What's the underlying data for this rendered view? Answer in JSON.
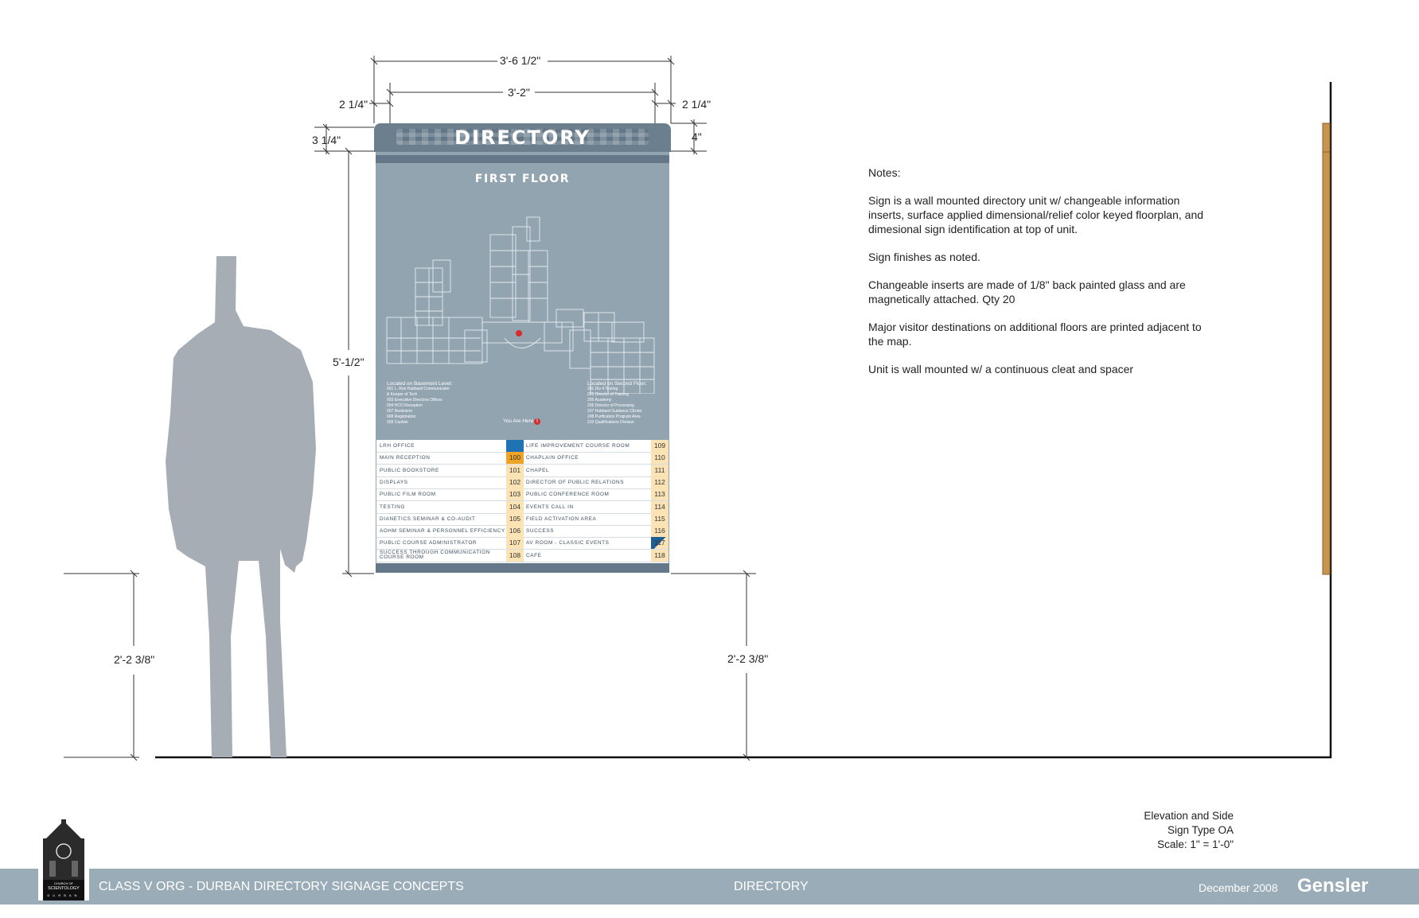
{
  "dimensions": {
    "overall_width": "3'-6 1/2\"",
    "inner_width": "3'-2\"",
    "left_offset": "2 1/4\"",
    "right_offset": "2 1/4\"",
    "header_height_left": "3 1/4\"",
    "header_height_right": "4\"",
    "sign_height": "5'-1/2\"",
    "mount_height_left": "2'-2 3/8\"",
    "mount_height_right": "2'-2 3/8\""
  },
  "sign": {
    "title": "DIRECTORY",
    "floor": "FIRST FLOOR",
    "basement_heading": "Located on Basement Level:",
    "basement_items": [
      "001   L. Ron Hubbard Communicator",
      "         & Keeper of Tech",
      "003   Executive Directors Offices",
      "004   HCO Reception",
      "007   Bookstore",
      "008   Registration",
      "009   Cashier"
    ],
    "second_heading": "Located on Second Floor:",
    "second_items": [
      "201   Div 4 Testing",
      "202   Director of Training",
      "205   Academy",
      "206   Director of Processing",
      "207   Hubbard Guidance CEnter",
      "208   Purification Program Area",
      "210   Qualifications Division"
    ],
    "you_are_here": "You Are Here",
    "you_are_here_marker": "!",
    "rows": [
      {
        "left": "LRH OFFICE",
        "lnum": "",
        "rnum_label": "LIFE IMPROVEMENT COURSE ROOM",
        "rnum": "109"
      },
      {
        "left": "MAIN RECEPTION",
        "lnum": "100",
        "rnum_label": "CHAPLAIN OFFICE",
        "rnum": "110"
      },
      {
        "left": "PUBLIC BOOKSTORE",
        "lnum": "101",
        "rnum_label": "CHAPEL",
        "rnum": "111"
      },
      {
        "left": "DISPLAYS",
        "lnum": "102",
        "rnum_label": "DIRECTOR OF PUBLIC RELATIONS",
        "rnum": "112"
      },
      {
        "left": "PUBLIC FILM ROOM",
        "lnum": "103",
        "rnum_label": "PUBLIC CONFERENCE ROOM",
        "rnum": "113"
      },
      {
        "left": "TESTING",
        "lnum": "104",
        "rnum_label": "EVENTS CALL IN",
        "rnum": "114"
      },
      {
        "left": "DIANETICS SEMINAR & CO-AUDIT",
        "lnum": "105",
        "rnum_label": "FIELD ACTIVATION AREA",
        "rnum": "115"
      },
      {
        "left": "AOHM SEMINAR & PERSONNEL EFFICIENCY",
        "lnum": "106",
        "rnum_label": "SUCCESS",
        "rnum": "116"
      },
      {
        "left": "PUBLIC COURSE ADMINISTRATOR",
        "lnum": "107",
        "rnum_label": "AV ROOM - CLASSIC EVENTS",
        "rnum": "117"
      },
      {
        "left": "SUCCESS THROUGH COMMUNICATION COURSE ROOM",
        "lnum": "108",
        "rnum_label": "CAFE",
        "rnum": "118"
      }
    ]
  },
  "notes": {
    "heading": "Notes:",
    "items": [
      "Sign is a wall mounted directory unit w/ changeable information inserts, surface applied dimensional/relief color keyed floorplan, and dimesional sign identification at top of unit.",
      "Sign finishes as noted.",
      "Changeable inserts are made of 1/8\" back painted glass and are magnetically attached. Qty 20",
      "Major visitor destinations on additional floors are printed adjacent to the map.",
      "Unit is wall mounted w/ a continuous cleat and spacer"
    ]
  },
  "title_block": {
    "line1": "Elevation and Side",
    "line2": "Sign Type OA",
    "line3": "Scale: 1\" = 1'-0\""
  },
  "footer": {
    "project": "CLASS V ORG - DURBAN DIRECTORY SIGNAGE CONCEPTS",
    "sheet": "DIRECTORY",
    "date": "December 2008",
    "firm": "Gensler"
  },
  "logo": {
    "line1": "CHURCH OF",
    "line2": "SCIENTOLOGY",
    "line3": "DURBAN"
  },
  "colors": {
    "sign_body": "#93a4b1",
    "sign_header": "#6b7f8f",
    "footer_bar": "#9aacb7",
    "highlight": "#f0a325",
    "number_bg": "#fbe3b5",
    "wood": "#c8954f",
    "figure": "#a7adb4"
  }
}
